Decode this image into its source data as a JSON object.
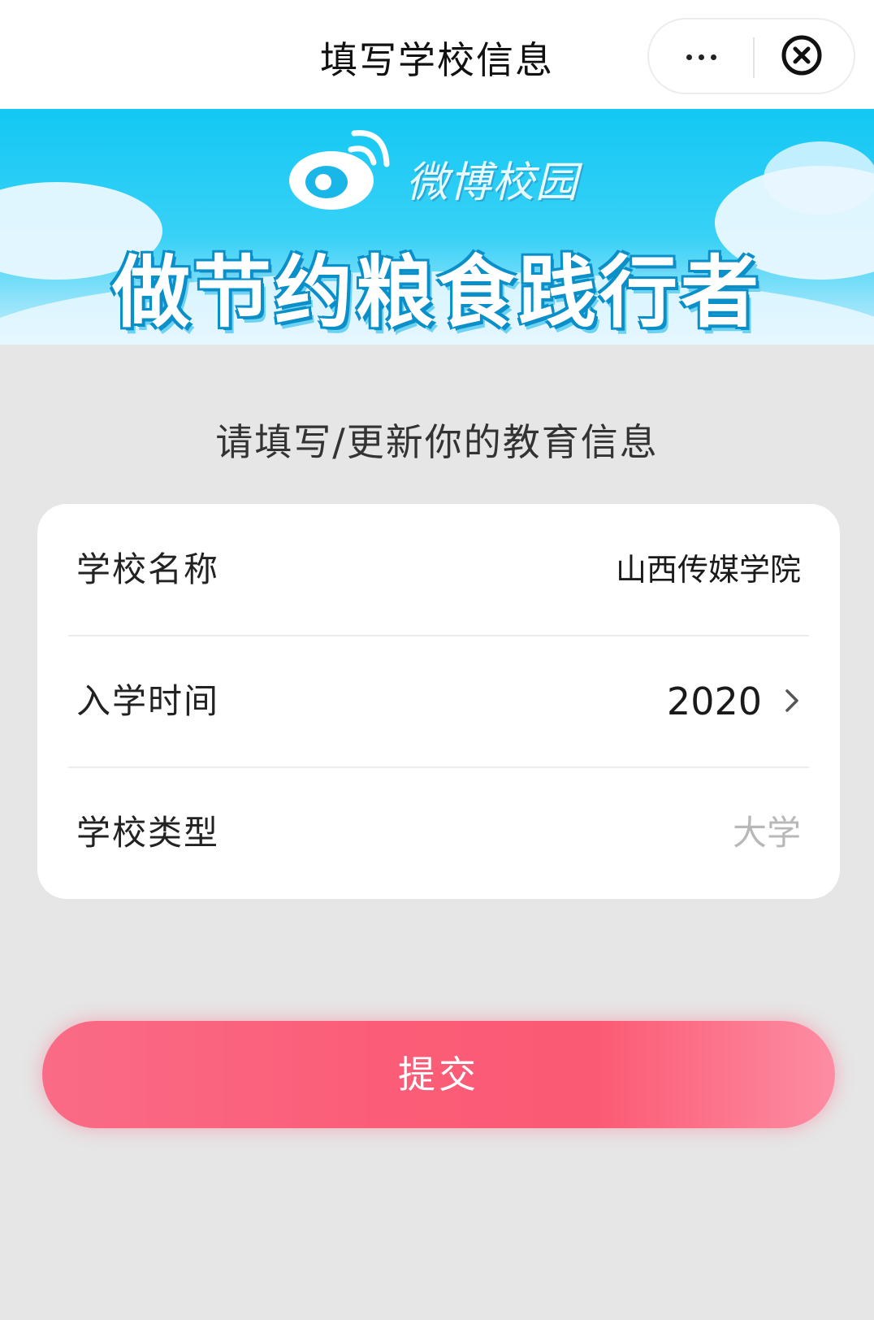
{
  "navbar": {
    "title": "填写学校信息",
    "more_icon": "more-dots-icon",
    "close_icon": "close-circle-icon"
  },
  "banner": {
    "logo_icon": "weibo-logo-icon",
    "subtitle": "微博校园",
    "headline": "做节约粮食践行者",
    "colors": {
      "sky_top": "#13c8f4",
      "sky_bottom": "#cdeffc"
    }
  },
  "form": {
    "heading": "请填写/更新你的教育信息",
    "rows": [
      {
        "label": "学校名称",
        "value": "山西传媒学院"
      },
      {
        "label": "入学时间",
        "value": "2020",
        "icon": "chevron-right-icon"
      },
      {
        "label": "学校类型",
        "value": "大学"
      }
    ]
  },
  "submit": {
    "label": "提交",
    "color": "#fb5c77"
  },
  "colors": {
    "page_bg": "#e6e6e6",
    "card_bg": "#ffffff",
    "muted_text": "#b8b8b8"
  }
}
